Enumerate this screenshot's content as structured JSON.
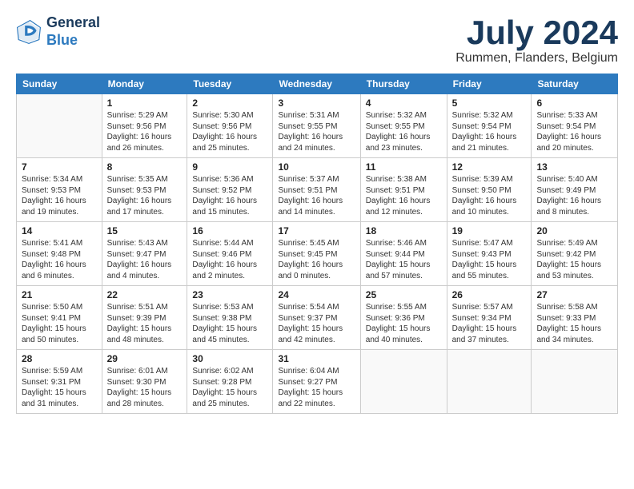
{
  "logo": {
    "line1": "General",
    "line2": "Blue"
  },
  "title": "July 2024",
  "location": "Rummen, Flanders, Belgium",
  "days_header": [
    "Sunday",
    "Monday",
    "Tuesday",
    "Wednesday",
    "Thursday",
    "Friday",
    "Saturday"
  ],
  "weeks": [
    [
      {
        "day": "",
        "info": ""
      },
      {
        "day": "1",
        "info": "Sunrise: 5:29 AM\nSunset: 9:56 PM\nDaylight: 16 hours\nand 26 minutes."
      },
      {
        "day": "2",
        "info": "Sunrise: 5:30 AM\nSunset: 9:56 PM\nDaylight: 16 hours\nand 25 minutes."
      },
      {
        "day": "3",
        "info": "Sunrise: 5:31 AM\nSunset: 9:55 PM\nDaylight: 16 hours\nand 24 minutes."
      },
      {
        "day": "4",
        "info": "Sunrise: 5:32 AM\nSunset: 9:55 PM\nDaylight: 16 hours\nand 23 minutes."
      },
      {
        "day": "5",
        "info": "Sunrise: 5:32 AM\nSunset: 9:54 PM\nDaylight: 16 hours\nand 21 minutes."
      },
      {
        "day": "6",
        "info": "Sunrise: 5:33 AM\nSunset: 9:54 PM\nDaylight: 16 hours\nand 20 minutes."
      }
    ],
    [
      {
        "day": "7",
        "info": "Sunrise: 5:34 AM\nSunset: 9:53 PM\nDaylight: 16 hours\nand 19 minutes."
      },
      {
        "day": "8",
        "info": "Sunrise: 5:35 AM\nSunset: 9:53 PM\nDaylight: 16 hours\nand 17 minutes."
      },
      {
        "day": "9",
        "info": "Sunrise: 5:36 AM\nSunset: 9:52 PM\nDaylight: 16 hours\nand 15 minutes."
      },
      {
        "day": "10",
        "info": "Sunrise: 5:37 AM\nSunset: 9:51 PM\nDaylight: 16 hours\nand 14 minutes."
      },
      {
        "day": "11",
        "info": "Sunrise: 5:38 AM\nSunset: 9:51 PM\nDaylight: 16 hours\nand 12 minutes."
      },
      {
        "day": "12",
        "info": "Sunrise: 5:39 AM\nSunset: 9:50 PM\nDaylight: 16 hours\nand 10 minutes."
      },
      {
        "day": "13",
        "info": "Sunrise: 5:40 AM\nSunset: 9:49 PM\nDaylight: 16 hours\nand 8 minutes."
      }
    ],
    [
      {
        "day": "14",
        "info": "Sunrise: 5:41 AM\nSunset: 9:48 PM\nDaylight: 16 hours\nand 6 minutes."
      },
      {
        "day": "15",
        "info": "Sunrise: 5:43 AM\nSunset: 9:47 PM\nDaylight: 16 hours\nand 4 minutes."
      },
      {
        "day": "16",
        "info": "Sunrise: 5:44 AM\nSunset: 9:46 PM\nDaylight: 16 hours\nand 2 minutes."
      },
      {
        "day": "17",
        "info": "Sunrise: 5:45 AM\nSunset: 9:45 PM\nDaylight: 16 hours\nand 0 minutes."
      },
      {
        "day": "18",
        "info": "Sunrise: 5:46 AM\nSunset: 9:44 PM\nDaylight: 15 hours\nand 57 minutes."
      },
      {
        "day": "19",
        "info": "Sunrise: 5:47 AM\nSunset: 9:43 PM\nDaylight: 15 hours\nand 55 minutes."
      },
      {
        "day": "20",
        "info": "Sunrise: 5:49 AM\nSunset: 9:42 PM\nDaylight: 15 hours\nand 53 minutes."
      }
    ],
    [
      {
        "day": "21",
        "info": "Sunrise: 5:50 AM\nSunset: 9:41 PM\nDaylight: 15 hours\nand 50 minutes."
      },
      {
        "day": "22",
        "info": "Sunrise: 5:51 AM\nSunset: 9:39 PM\nDaylight: 15 hours\nand 48 minutes."
      },
      {
        "day": "23",
        "info": "Sunrise: 5:53 AM\nSunset: 9:38 PM\nDaylight: 15 hours\nand 45 minutes."
      },
      {
        "day": "24",
        "info": "Sunrise: 5:54 AM\nSunset: 9:37 PM\nDaylight: 15 hours\nand 42 minutes."
      },
      {
        "day": "25",
        "info": "Sunrise: 5:55 AM\nSunset: 9:36 PM\nDaylight: 15 hours\nand 40 minutes."
      },
      {
        "day": "26",
        "info": "Sunrise: 5:57 AM\nSunset: 9:34 PM\nDaylight: 15 hours\nand 37 minutes."
      },
      {
        "day": "27",
        "info": "Sunrise: 5:58 AM\nSunset: 9:33 PM\nDaylight: 15 hours\nand 34 minutes."
      }
    ],
    [
      {
        "day": "28",
        "info": "Sunrise: 5:59 AM\nSunset: 9:31 PM\nDaylight: 15 hours\nand 31 minutes."
      },
      {
        "day": "29",
        "info": "Sunrise: 6:01 AM\nSunset: 9:30 PM\nDaylight: 15 hours\nand 28 minutes."
      },
      {
        "day": "30",
        "info": "Sunrise: 6:02 AM\nSunset: 9:28 PM\nDaylight: 15 hours\nand 25 minutes."
      },
      {
        "day": "31",
        "info": "Sunrise: 6:04 AM\nSunset: 9:27 PM\nDaylight: 15 hours\nand 22 minutes."
      },
      {
        "day": "",
        "info": ""
      },
      {
        "day": "",
        "info": ""
      },
      {
        "day": "",
        "info": ""
      }
    ]
  ]
}
